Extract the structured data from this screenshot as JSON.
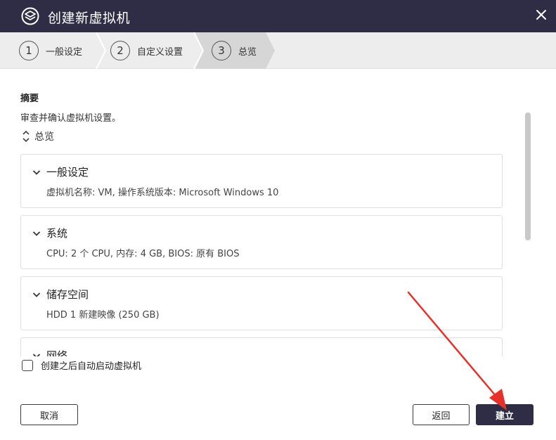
{
  "window": {
    "title": "创建新虚拟机",
    "close_icon": "close-icon",
    "logo_icon": "vm-logo-icon"
  },
  "wizard_steps": [
    {
      "number": "1",
      "label": "一般设定",
      "active": false
    },
    {
      "number": "2",
      "label": "自定义设置",
      "active": false
    },
    {
      "number": "3",
      "label": "总览",
      "active": true
    }
  ],
  "summary": {
    "title": "摘要",
    "description": "审查并确认虚拟机设置。",
    "overview_label": "总览"
  },
  "cards": [
    {
      "title": "一般设定",
      "detail": "虚拟机名称: VM, 操作系统版本: Microsoft Windows 10"
    },
    {
      "title": "系统",
      "detail": "CPU: 2 个 CPU, 内存: 4 GB, BIOS: 原有 BIOS"
    },
    {
      "title": "储存空间",
      "detail": "HDD 1 新建映像 (250 GB)"
    },
    {
      "title": "网络",
      "detail": ""
    }
  ],
  "autostart": {
    "label": "创建之后自动启动虚拟机",
    "checked": false
  },
  "buttons": {
    "cancel": "取消",
    "back": "返回",
    "create": "建立"
  },
  "colors": {
    "titlebar": "#2f2d46",
    "steps_bg": "#ededed",
    "active_step": "#d6d6d6",
    "primary_button": "#2f2d46",
    "annotation_arrow": "#e8302a"
  }
}
